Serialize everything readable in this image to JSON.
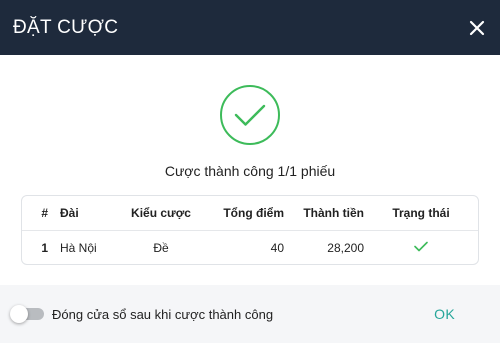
{
  "dialog": {
    "title": "ĐẶT CƯỢC"
  },
  "result": {
    "message": "Cược thành công 1/1 phiếu"
  },
  "table": {
    "headers": [
      "#",
      "Đài",
      "Kiểu cược",
      "Tổng điểm",
      "Thành tiền",
      "Trạng thái"
    ],
    "rows": [
      {
        "idx": "1",
        "dai": "Hà Nội",
        "kieu": "Đề",
        "tong": "40",
        "thanh": "28,200",
        "status_icon": "check-icon"
      }
    ]
  },
  "footer": {
    "toggle_label": "Đóng cửa sổ sau khi cược thành công",
    "toggle_on": false,
    "ok_label": "OK"
  },
  "colors": {
    "header_bg": "#1e2a3c",
    "success": "#3dbb5a",
    "ok": "#26a69a"
  }
}
